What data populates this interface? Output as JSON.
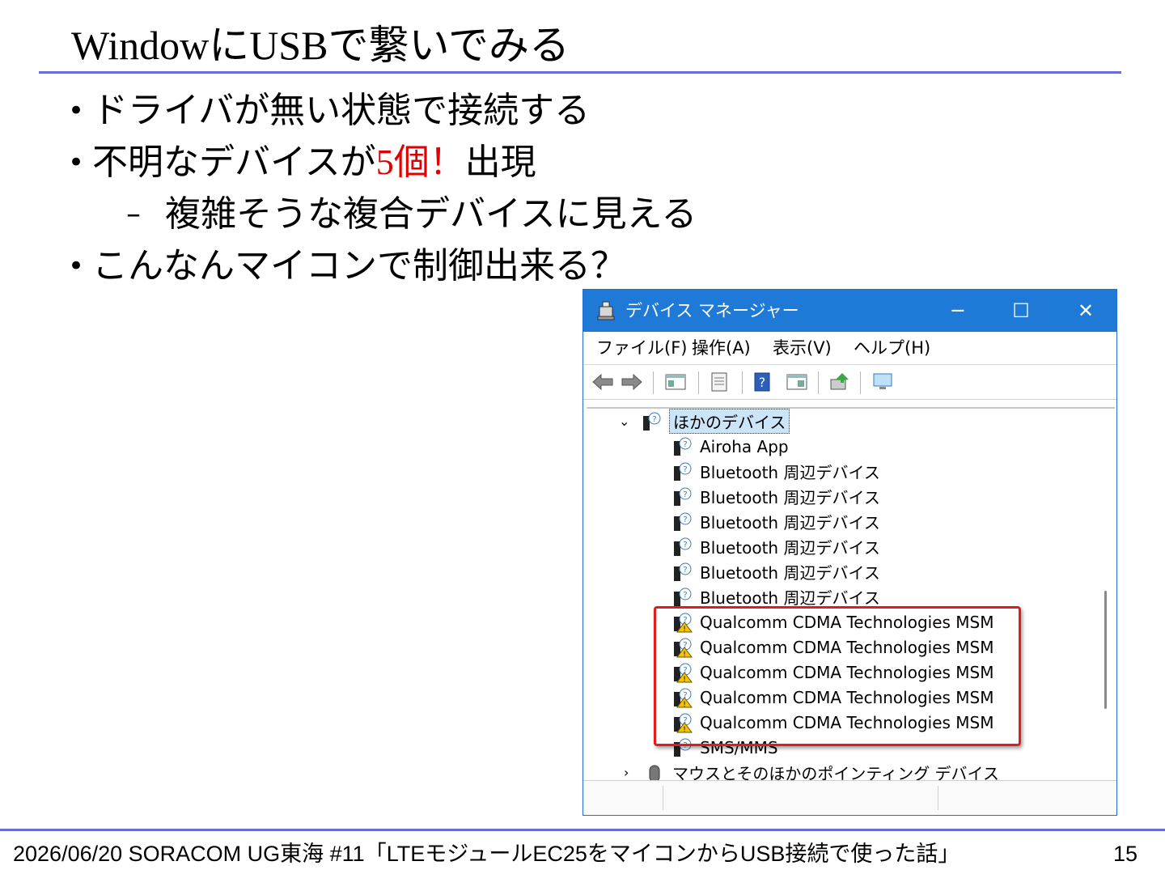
{
  "slide": {
    "title": "WindowにUSBで繋いでみる",
    "bullets": [
      "ドライバが無い状態で接続する",
      {
        "prefix": "不明なデバイスが",
        "highlight_num": "5",
        "highlight_text": "個！",
        "suffix": "出現"
      },
      "複雑そうな複合デバイスに見える",
      "こんなんマイコンで制御出来る？"
    ],
    "highlight_color": "#e00000"
  },
  "window": {
    "title": "デバイス マネージャー",
    "minimize": "─",
    "maximize": "☐",
    "close": "✕",
    "menu": [
      "ファイル(F)",
      "操作(A)",
      "表示(V)",
      "ヘルプ(H)"
    ],
    "toolbar_icons": [
      "back-icon",
      "forward-icon",
      "show-hide-console-tree-icon",
      "properties-icon",
      "help-icon",
      "action-pane-icon",
      "update-driver-icon",
      "monitor-icon"
    ],
    "tree": {
      "category": "ほかのデバイス",
      "items": [
        {
          "label": "Airoha App",
          "warning": false
        },
        {
          "label": "Bluetooth 周辺デバイス",
          "warning": false
        },
        {
          "label": "Bluetooth 周辺デバイス",
          "warning": false
        },
        {
          "label": "Bluetooth 周辺デバイス",
          "warning": false
        },
        {
          "label": "Bluetooth 周辺デバイス",
          "warning": false
        },
        {
          "label": "Bluetooth 周辺デバイス",
          "warning": false
        },
        {
          "label": "Bluetooth 周辺デバイス",
          "warning": false
        },
        {
          "label": "Qualcomm CDMA Technologies MSM",
          "warning": true
        },
        {
          "label": "Qualcomm CDMA Technologies MSM",
          "warning": true
        },
        {
          "label": "Qualcomm CDMA Technologies MSM",
          "warning": true
        },
        {
          "label": "Qualcomm CDMA Technologies MSM",
          "warning": true
        },
        {
          "label": "Qualcomm CDMA Technologies MSM",
          "warning": true
        },
        {
          "label": "SMS/MMS",
          "warning": false
        }
      ],
      "next_category": "マウスとそのほかのポインティング デバイス"
    },
    "accent_color": "#1e7ad6",
    "highlight_box_color": "#e21b1b"
  },
  "footer": {
    "text": "2026/06/20 SORACOM UG東海 #11「LTEモジュールEC25をマイコンからUSB接続で使った話」",
    "page": "15"
  }
}
